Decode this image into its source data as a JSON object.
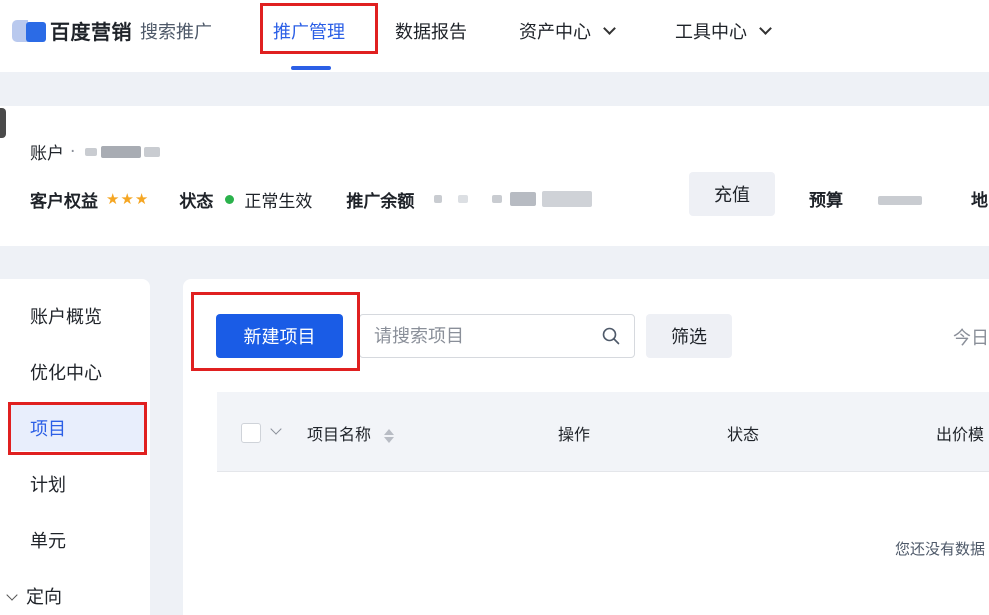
{
  "brand": {
    "name": "百度营销",
    "product": "搜索推广"
  },
  "nav": {
    "items": [
      {
        "label": "推广管理",
        "active": true
      },
      {
        "label": "数据报告"
      },
      {
        "label": "资产中心",
        "dropdown": true
      },
      {
        "label": "工具中心",
        "dropdown": true
      }
    ]
  },
  "account": {
    "label": "账户",
    "separator": "·",
    "rights_label": "客户权益",
    "stars": "★★★",
    "status_label": "状态",
    "status_value": "正常生效",
    "balance_label": "推广余额",
    "charge_button": "充值",
    "budget_label": "预算",
    "region_label": "地"
  },
  "sidebar": {
    "items": [
      {
        "label": "账户概览"
      },
      {
        "label": "优化中心"
      },
      {
        "label": "项目",
        "active": true
      },
      {
        "label": "计划"
      },
      {
        "label": "单元"
      },
      {
        "label": "定向",
        "expandable": true
      }
    ]
  },
  "toolbar": {
    "new_button": "新建项目",
    "search_placeholder": "请搜索项目",
    "filter_button": "筛选",
    "date_label": "今日"
  },
  "table": {
    "columns": [
      "项目名称",
      "操作",
      "状态",
      "出价模"
    ],
    "empty_text": "您还没有数据"
  },
  "colors": {
    "accent": "#2b5fe6",
    "primary_button": "#1a5ce6",
    "highlight": "#e02020",
    "star": "#f5a623",
    "status_ok": "#2bb24c"
  }
}
